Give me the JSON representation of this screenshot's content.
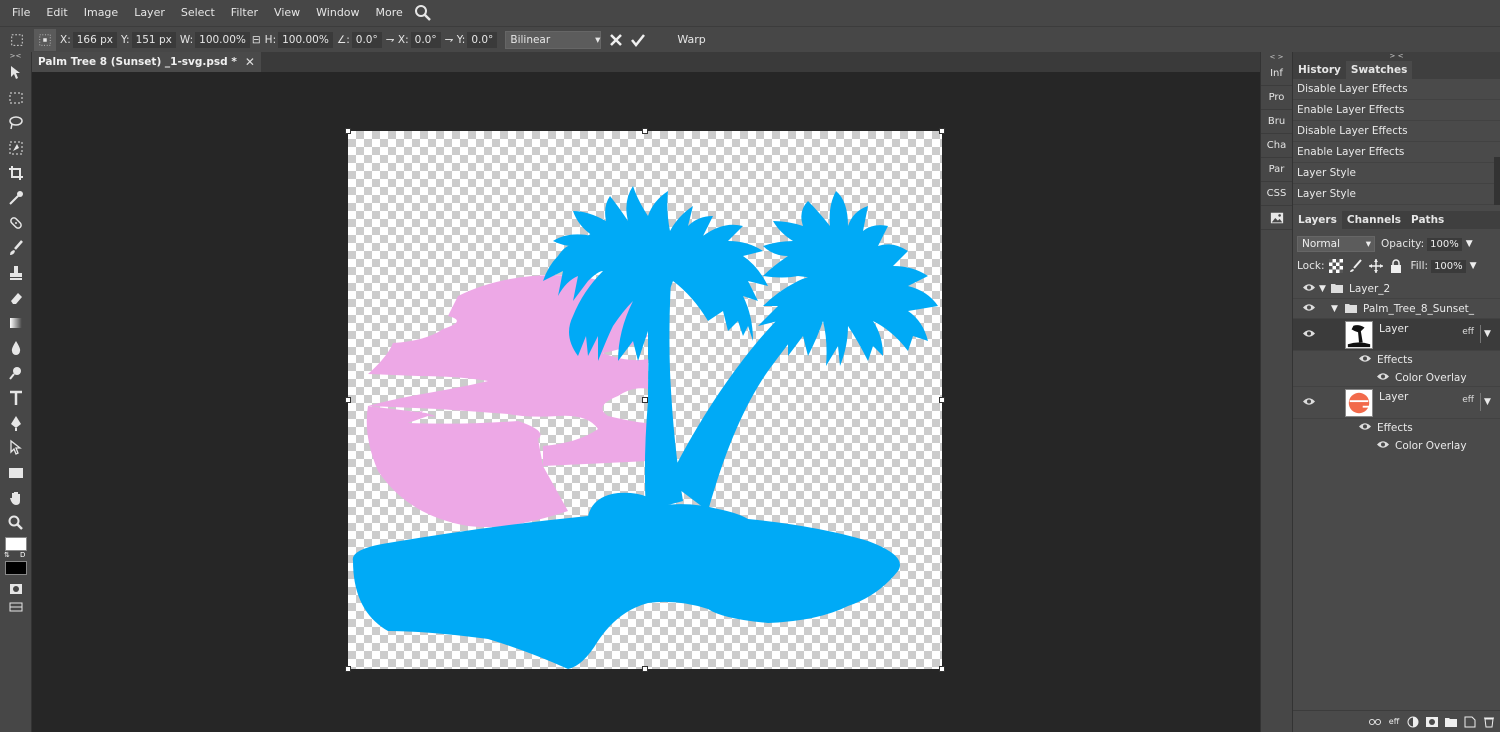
{
  "menu": [
    "File",
    "Edit",
    "Image",
    "Layer",
    "Select",
    "Filter",
    "View",
    "Window",
    "More"
  ],
  "options": {
    "x_label": "X:",
    "x_value": "166 px",
    "y_label": "Y:",
    "y_value": "151 px",
    "w_label": "W:",
    "w_value": "100.00%",
    "h_label": "H:",
    "h_value": "100.00%",
    "angle_label": "∠:",
    "angle_value": "0.0°",
    "skewx_label": "⇁ X:",
    "skewx_value": "0.0°",
    "skewy_label": "⇁ Y:",
    "skewy_value": "0.0°",
    "interpolation": "Bilinear",
    "warp_label": "Warp"
  },
  "document": {
    "tab_title": "Palm Tree 8 (Sunset) _1-svg.psd *",
    "close": "✕"
  },
  "side_panels": [
    "Inf",
    "Pro",
    "Bru",
    "Cha",
    "Par",
    "CSS"
  ],
  "history": {
    "tabs": [
      "History",
      "Swatches"
    ],
    "items": [
      "Disable Layer Effects",
      "Enable Layer Effects",
      "Disable Layer Effects",
      "Enable Layer Effects",
      "Layer Style",
      "Layer Style"
    ]
  },
  "layers_panel": {
    "tabs": [
      "Layers",
      "Channels",
      "Paths"
    ],
    "blend_mode": "Normal",
    "opacity_label": "Opacity:",
    "opacity_value": "100%",
    "lock_label": "Lock:",
    "fill_label": "Fill:",
    "fill_value": "100%",
    "rows": {
      "folder1": "Layer_2",
      "folder2": "Palm_Tree_8_Sunset_",
      "layer1": "Layer",
      "layer1_eff": "eff",
      "effects1": "Effects",
      "overlay1": "Color Overlay",
      "layer2": "Layer",
      "layer2_eff": "eff",
      "effects2": "Effects",
      "overlay2": "Color Overlay"
    },
    "footer_eff": "eff"
  },
  "colors": {
    "palm": "#00aaf6",
    "sun": "#eda8e6",
    "layer2_thumb": "#f26a4b"
  }
}
